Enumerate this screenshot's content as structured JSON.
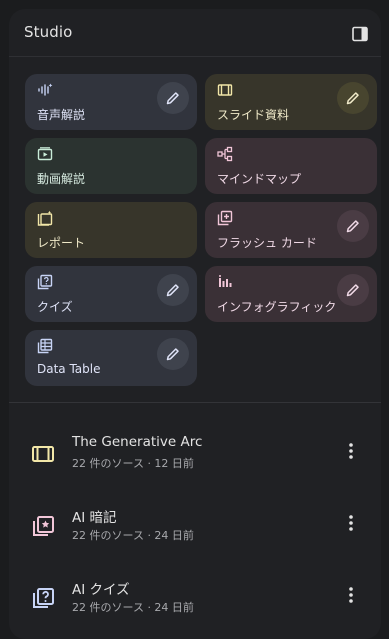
{
  "panel": {
    "title": "Studio"
  },
  "tiles": [
    {
      "label": "音声解説",
      "icon": "audio-waveform-icon",
      "has_edit": true,
      "color": "#31343d"
    },
    {
      "label": "スライド資料",
      "icon": "slides-icon",
      "has_edit": true,
      "color": "#37352a"
    },
    {
      "label": "動画解説",
      "icon": "video-icon",
      "has_edit": false,
      "color": "#2b3330"
    },
    {
      "label": "マインドマップ",
      "icon": "mind-map-icon",
      "has_edit": false,
      "color": "#3a3036"
    },
    {
      "label": "レポート",
      "icon": "report-icon",
      "has_edit": false,
      "color": "#37352a"
    },
    {
      "label": "フラッシュ カード",
      "icon": "flashcards-icon",
      "has_edit": true,
      "color": "#3a3036"
    },
    {
      "label": "クイズ",
      "icon": "quiz-icon",
      "has_edit": true,
      "color": "#31343d"
    },
    {
      "label": "インフォグラフィック",
      "icon": "infographic-icon",
      "has_edit": true,
      "color": "#3a3036"
    },
    {
      "label": "Data Table",
      "icon": "data-table-icon",
      "has_edit": true,
      "color": "#31343d"
    }
  ],
  "outputs": [
    {
      "title": "The Generative Arc",
      "subtitle": "22 件のソース · 12 日前",
      "icon": "slides-icon",
      "color": "#f2e7a8"
    },
    {
      "title": "AI 暗記",
      "subtitle": "22 件のソース · 24 日前",
      "icon": "flashcards-icon",
      "color": "#f1c6d8"
    },
    {
      "title": "AI クイズ",
      "subtitle": "22 件のソース · 24 日前",
      "icon": "quiz-icon",
      "color": "#c8d4f6"
    }
  ]
}
